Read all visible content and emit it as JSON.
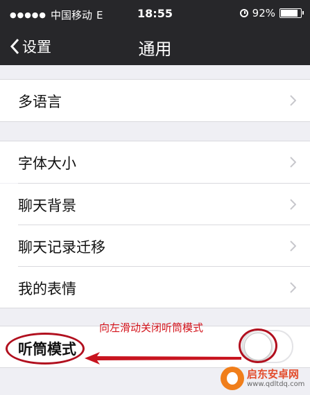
{
  "status_bar": {
    "carrier": "中国移动",
    "network": "E",
    "time": "18:55",
    "battery": "92%",
    "battery_level": 0.92,
    "alarm_icon": "alarm-icon"
  },
  "nav": {
    "back_label": "设置",
    "title": "通用"
  },
  "list": {
    "multilang": "多语言",
    "font_size": "字体大小",
    "chat_background": "聊天背景",
    "chat_history_migrate": "聊天记录迁移",
    "my_stickers": "我的表情",
    "earpiece_mode": "听筒模式"
  },
  "toggle": {
    "state": "off"
  },
  "annotation": {
    "text": "向左滑动关闭听筒模式",
    "color": "#d3131b"
  },
  "watermark": {
    "name": "启东安卓网",
    "url": "www.qdltdq.com"
  },
  "colors": {
    "bar": "#27272a",
    "background": "#efeff4",
    "annotation_red": "#b10f1e"
  }
}
